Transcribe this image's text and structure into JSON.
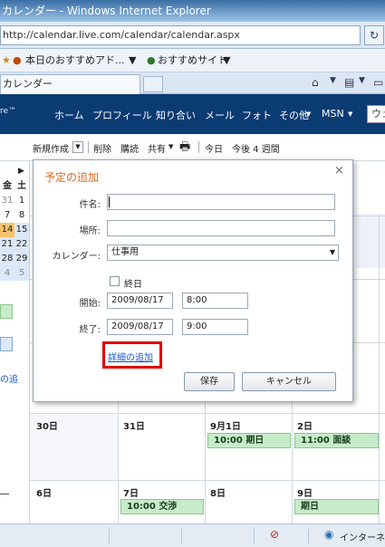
{
  "window": {
    "title": "カレンダー - Windows Internet Explorer"
  },
  "address": {
    "url": "http://calendar.live.com/calendar/calendar.aspx",
    "go_label": "↻"
  },
  "favorites": {
    "item1": "本日のおすすめアド...",
    "item2": "おすすめサイト"
  },
  "tab": {
    "label": "カレンダー"
  },
  "livenav": {
    "brand": "re™",
    "items": [
      "ホーム",
      "プロフィール",
      "知り合い",
      "メール",
      "フォト",
      "その他",
      "MSN"
    ],
    "search_text": "ウェ"
  },
  "toolbar": {
    "new": "新規作成",
    "delete": "削除",
    "subscribe": "購読",
    "share": "共有",
    "print_icon": "printer-icon",
    "today": "今日",
    "next4weeks": "今後 4 週間"
  },
  "minical": {
    "headers": [
      "金",
      "土"
    ],
    "rows": [
      [
        "31",
        "1"
      ],
      [
        "7",
        "8"
      ],
      [
        "14",
        "15"
      ],
      [
        "21",
        "22"
      ],
      [
        "28",
        "29"
      ],
      [
        "4",
        "5"
      ]
    ],
    "highlight": "14",
    "link": "の追"
  },
  "grid": {
    "days_row1": [
      "30日",
      "31日",
      "9月1日",
      "2日"
    ],
    "days_row2": [
      "6日",
      "7日",
      "8日",
      "9日"
    ],
    "events": [
      {
        "label": "10:00 期日"
      },
      {
        "label": "11:00 面談"
      },
      {
        "label": "10:00 交渉"
      },
      {
        "label": "期日"
      }
    ]
  },
  "dialog": {
    "title": "予定の追加",
    "close": "×",
    "subject_label": "件名:",
    "subject_value": "",
    "location_label": "場所:",
    "location_value": "",
    "calendar_label": "カレンダー:",
    "calendar_value": "仕事用",
    "allday_label": "終日",
    "start_label": "開始:",
    "start_date": "2009/08/17",
    "start_time": "8:00",
    "end_label": "終了:",
    "end_date": "2009/08/17",
    "end_time": "9:00",
    "details_link": "詳細の追加",
    "save": "保存",
    "cancel": "キャンセル"
  },
  "status": {
    "zone": "インターネ"
  },
  "colors": {
    "accent_orange": "#e0661a",
    "highlight_red": "#e00000",
    "link_blue": "#1a55c7",
    "event_green": "#c7ecc9"
  }
}
